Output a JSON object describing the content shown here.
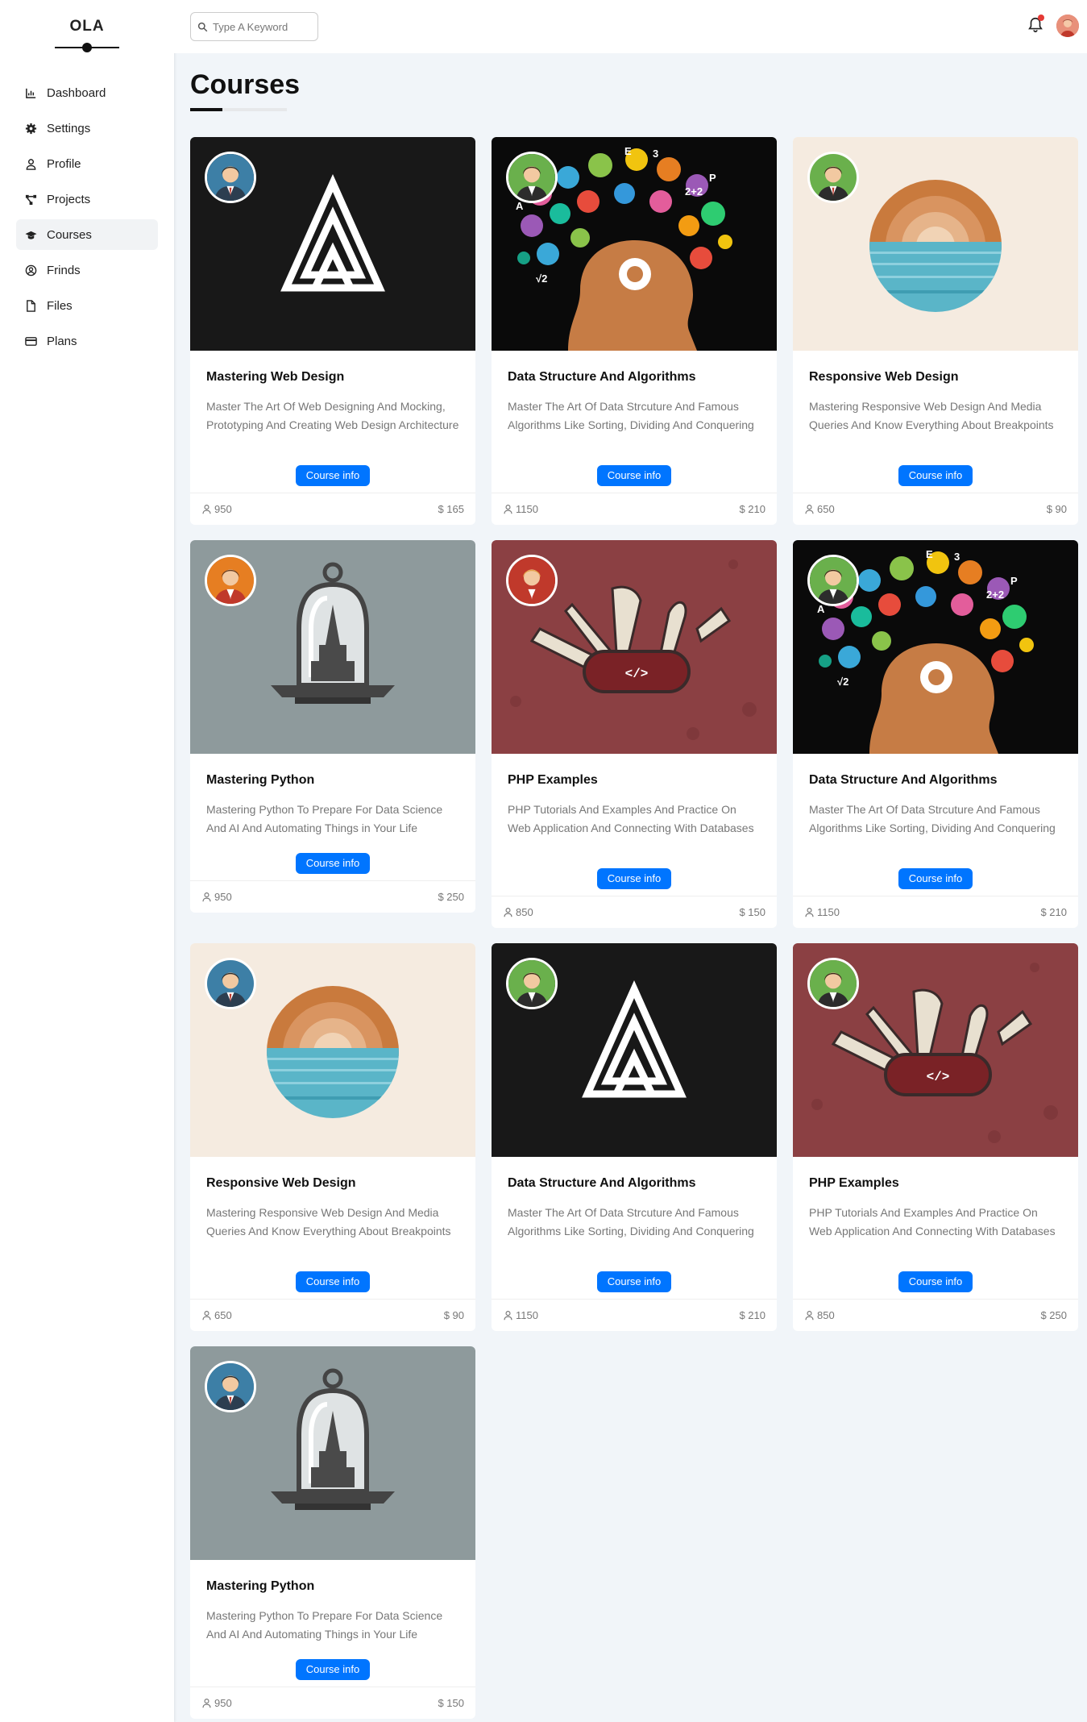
{
  "sidebar": {
    "logo": "OLA",
    "items": [
      {
        "label": "Dashboard",
        "icon": "chart-area-icon"
      },
      {
        "label": "Settings",
        "icon": "gear-icon"
      },
      {
        "label": "Profile",
        "icon": "user-icon"
      },
      {
        "label": "Projects",
        "icon": "diagram-project-icon"
      },
      {
        "label": "Courses",
        "icon": "graduation-cap-icon",
        "active": true
      },
      {
        "label": "Frinds",
        "icon": "circle-user-icon"
      },
      {
        "label": "Files",
        "icon": "file-icon"
      },
      {
        "label": "Plans",
        "icon": "credit-card-icon"
      }
    ]
  },
  "header": {
    "search_placeholder": "Type A Keyword",
    "notification_dot_color": "#e53935"
  },
  "page": {
    "title": "Courses"
  },
  "colors": {
    "accent": "#0075ff",
    "page_bg": "#f1f5f9"
  },
  "cards": [
    {
      "title": "Mastering Web Design",
      "desc": "Master The Art Of Web Designing And Mocking, Prototyping And Creating Web Design Architecture",
      "students": "950",
      "price": "$ 165",
      "button": "Course info",
      "image": "dark-a-logo",
      "avatar": "man-blue"
    },
    {
      "title": "Data Structure And Algorithms",
      "desc": "Master The Art Of Data Strcuture And Famous Algorithms Like Sorting, Dividing And Conquering",
      "students": "1150",
      "price": "$ 210",
      "button": "Course info",
      "image": "brain-head",
      "avatar": "woman-green"
    },
    {
      "title": "Responsive Web Design",
      "desc": "Mastering Responsive Web Design And Media Queries And Know Everything About Breakpoints",
      "students": "650",
      "price": "$ 90",
      "button": "Course info",
      "image": "sunset-circle",
      "avatar": "man-green"
    },
    {
      "title": "Mastering Python",
      "desc": "Mastering Python To Prepare For Data Science And AI And Automating Things in Your Life",
      "students": "950",
      "price": "$ 250",
      "button": "Course info",
      "image": "bell-jar",
      "avatar": "woman-orange"
    },
    {
      "title": "PHP Examples",
      "desc": "PHP Tutorials And Examples And Practice On Web Application And Connecting With Databases",
      "students": "850",
      "price": "$ 150",
      "button": "Course info",
      "image": "swiss-knife",
      "avatar": "woman-red"
    },
    {
      "title": "Data Structure And Algorithms",
      "desc": "Master The Art Of Data Strcuture And Famous Algorithms Like Sorting, Dividing And Conquering",
      "students": "1150",
      "price": "$ 210",
      "button": "Course info",
      "image": "brain-head",
      "avatar": "woman-green"
    },
    {
      "title": "Responsive Web Design",
      "desc": "Mastering Responsive Web Design And Media Queries And Know Everything About Breakpoints",
      "students": "650",
      "price": "$ 90",
      "button": "Course info",
      "image": "sunset-circle",
      "avatar": "man-blue"
    },
    {
      "title": "Data Structure And Algorithms",
      "desc": "Master The Art Of Data Strcuture And Famous Algorithms Like Sorting, Dividing And Conquering",
      "students": "1150",
      "price": "$ 210",
      "button": "Course info",
      "image": "dark-a-logo",
      "avatar": "woman-green"
    },
    {
      "title": "PHP Examples",
      "desc": "PHP Tutorials And Examples And Practice On Web Application And Connecting With Databases",
      "students": "850",
      "price": "$ 250",
      "button": "Course info",
      "image": "swiss-knife",
      "avatar": "woman-green"
    },
    {
      "title": "Mastering Python",
      "desc": "Mastering Python To Prepare For Data Science And AI And Automating Things in Your Life",
      "students": "950",
      "price": "$ 150",
      "button": "Course info",
      "image": "bell-jar",
      "avatar": "man-blue"
    }
  ]
}
